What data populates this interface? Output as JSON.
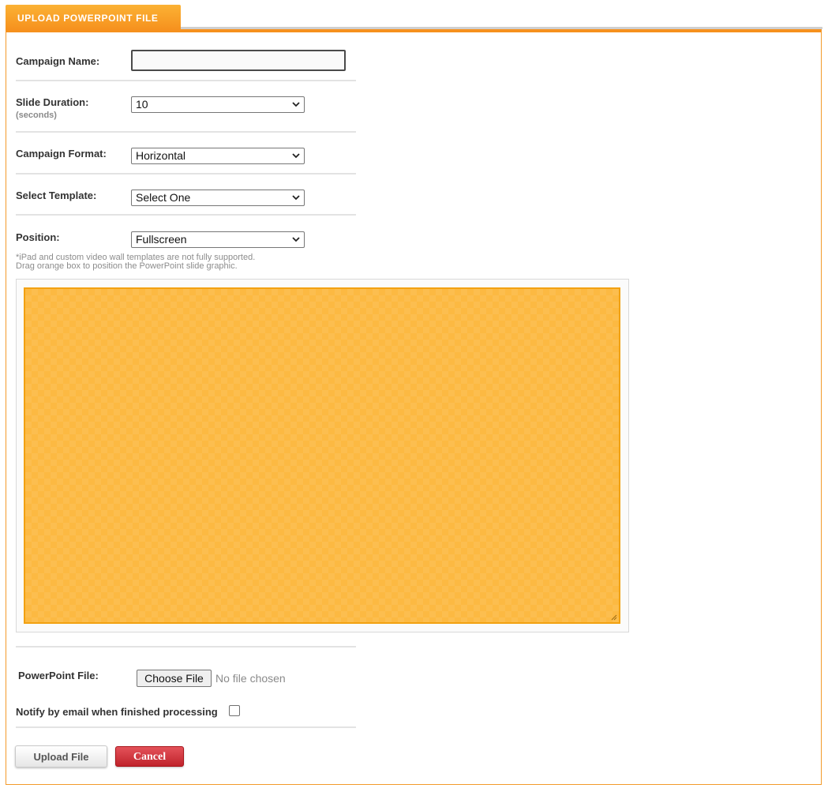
{
  "header": {
    "tab_label": "UPLOAD POWERPOINT FILE"
  },
  "form": {
    "campaign_name": {
      "label": "Campaign Name:",
      "value": ""
    },
    "slide_duration": {
      "label": "Slide Duration:",
      "sublabel": "(seconds)",
      "value": "10"
    },
    "campaign_format": {
      "label": "Campaign Format:",
      "value": "Horizontal"
    },
    "select_template": {
      "label": "Select Template:",
      "value": "Select One"
    },
    "position": {
      "label": "Position:",
      "value": "Fullscreen"
    },
    "note_line1": "*iPad and custom video wall templates are not fully supported.",
    "note_line2": "Drag orange box to position the PowerPoint slide graphic.",
    "powerpoint_file": {
      "label": "PowerPoint File:",
      "button": "Choose File",
      "status": "No file chosen"
    },
    "notify": {
      "label": "Notify by email when finished processing",
      "checked": false
    }
  },
  "actions": {
    "upload_label": "Upload File",
    "cancel_label": "Cancel"
  },
  "colors": {
    "accent_orange": "#f6911e",
    "slide_box_fill": "#fcb942",
    "cancel_red": "#c0232b"
  },
  "icons": {
    "select_arrow": "chevron-down-icon",
    "resize_handle": "resize-grip-icon"
  }
}
